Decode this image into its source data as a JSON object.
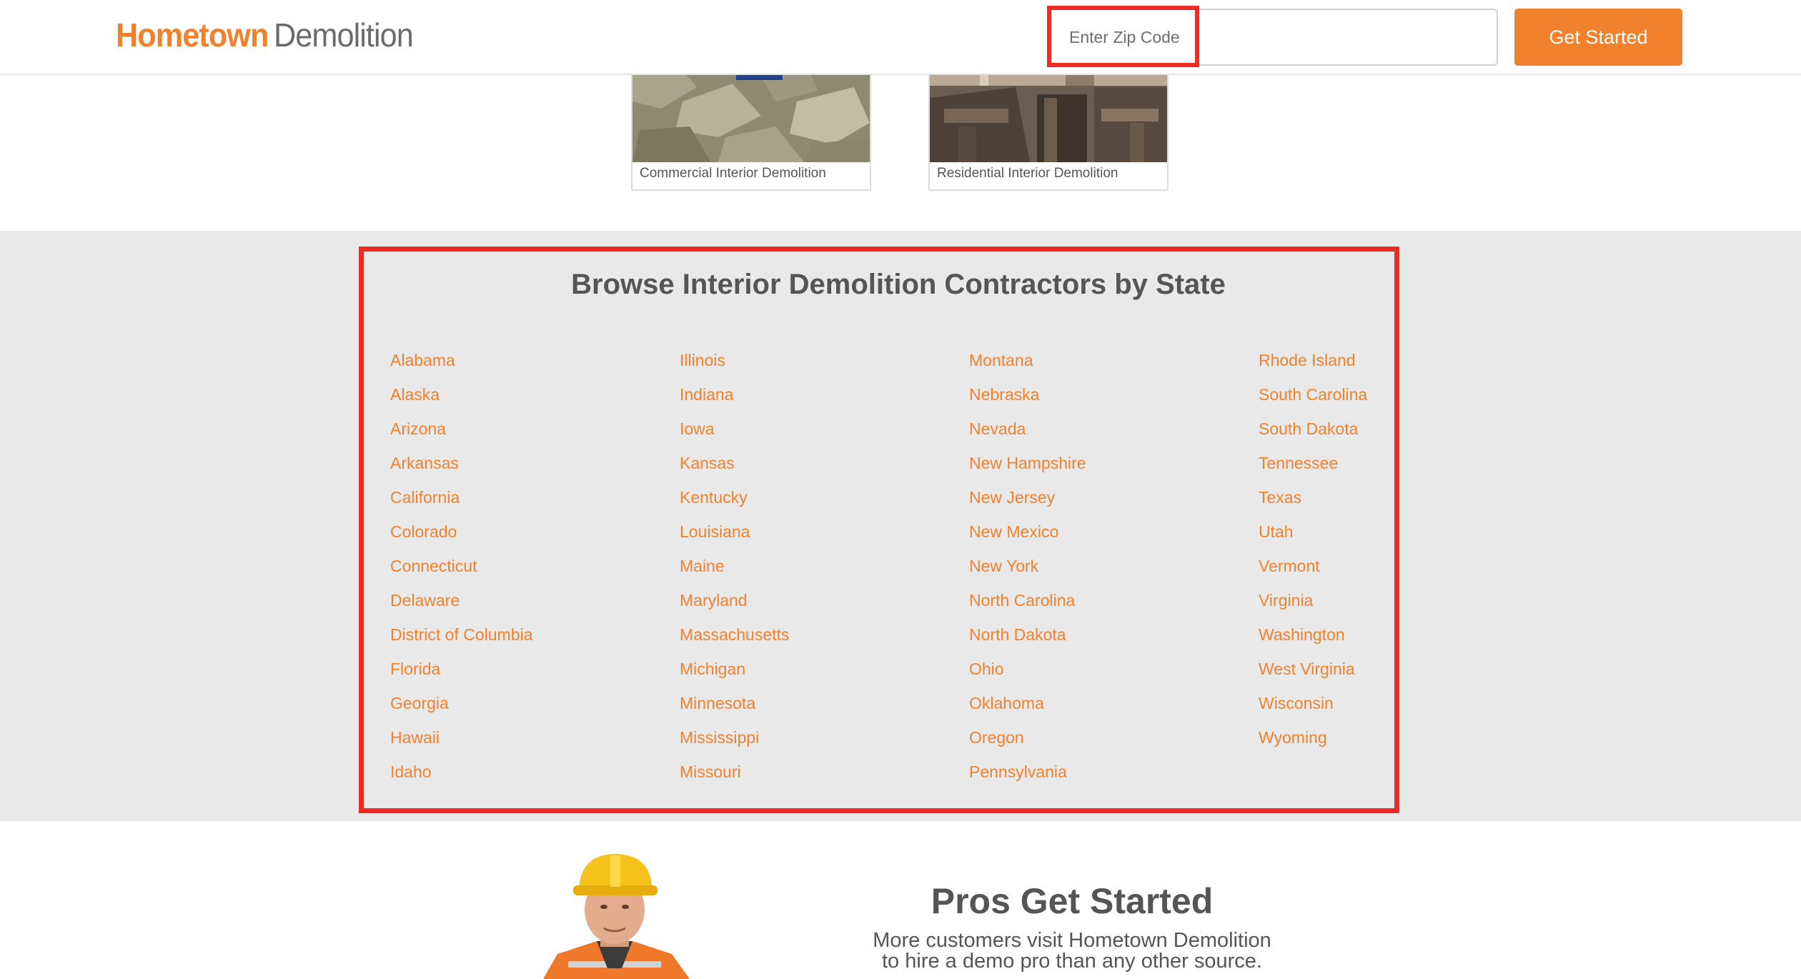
{
  "header": {
    "logo_part1": "Hometown",
    "logo_part2": "Demolition",
    "zip_placeholder": "Enter Zip Code",
    "button_label": "Get Started"
  },
  "cards": [
    {
      "caption": "Commercial Interior Demolition"
    },
    {
      "caption": "Residential Interior Demolition"
    }
  ],
  "browse": {
    "title": "Browse Interior Demolition Contractors by State",
    "columns": [
      [
        "Alabama",
        "Alaska",
        "Arizona",
        "Arkansas",
        "California",
        "Colorado",
        "Connecticut",
        "Delaware",
        "District of Columbia",
        "Florida",
        "Georgia",
        "Hawaii",
        "Idaho"
      ],
      [
        "Illinois",
        "Indiana",
        "Iowa",
        "Kansas",
        "Kentucky",
        "Louisiana",
        "Maine",
        "Maryland",
        "Massachusetts",
        "Michigan",
        "Minnesota",
        "Mississippi",
        "Missouri"
      ],
      [
        "Montana",
        "Nebraska",
        "Nevada",
        "New Hampshire",
        "New Jersey",
        "New Mexico",
        "New York",
        "North Carolina",
        "North Dakota",
        "Ohio",
        "Oklahoma",
        "Oregon",
        "Pennsylvania"
      ],
      [
        "Rhode Island",
        "South Carolina",
        "South Dakota",
        "Tennessee",
        "Texas",
        "Utah",
        "Vermont",
        "Virginia",
        "Washington",
        "West Virginia",
        "Wisconsin",
        "Wyoming"
      ]
    ]
  },
  "pros": {
    "title": "Pros Get Started",
    "line1": "More customers visit Hometown Demolition",
    "line2": "to hire a demo pro than any other source."
  },
  "colors": {
    "accent": "#f2812e",
    "highlight": "#ee2a24",
    "section_bg": "#e9e9e9",
    "text": "#555555"
  }
}
